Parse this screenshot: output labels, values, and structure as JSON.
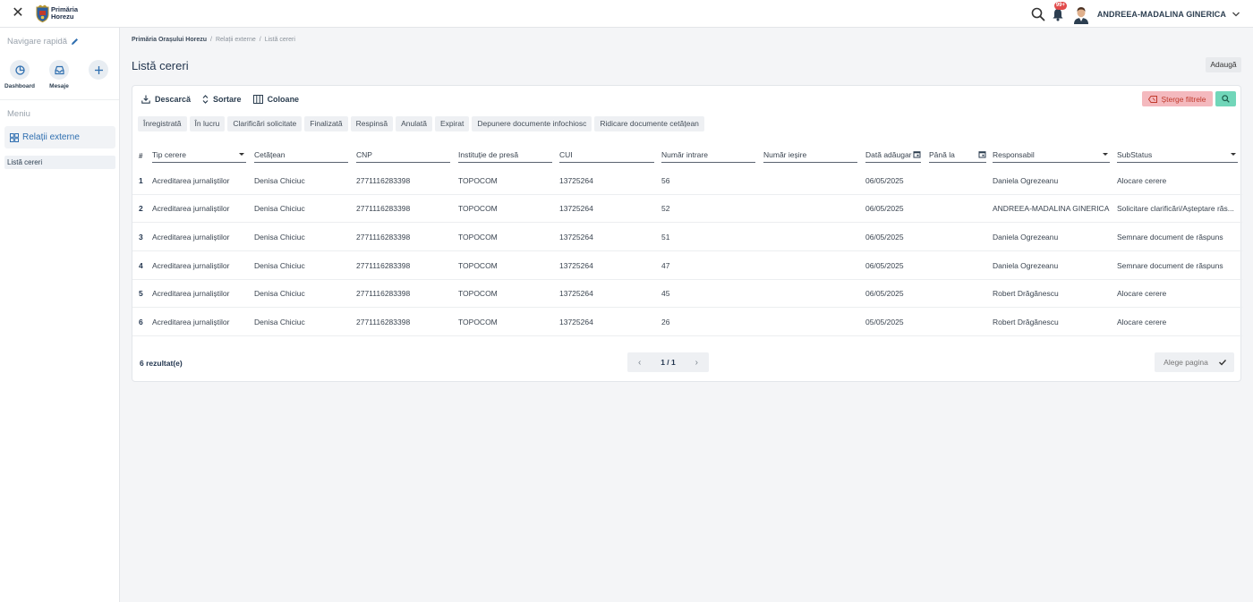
{
  "app": {
    "logo_line1": "Primăria",
    "logo_line2": "Horezu"
  },
  "topbar": {
    "notification_badge": "99+",
    "user_name": "ANDREEA-MADALINA GINERICA"
  },
  "sidebar": {
    "quick_nav_label": "Navigare rapidă",
    "quick_items": [
      {
        "label": "Dashboard",
        "icon": "pie-chart-icon"
      },
      {
        "label": "Mesaje",
        "icon": "inbox-icon"
      },
      {
        "label": "",
        "icon": "plus-icon"
      }
    ],
    "menu_heading": "Meniu",
    "menu_item": "Relații externe",
    "submenu_item": "Listă cereri"
  },
  "breadcrumb": {
    "root": "Primăria Orașului Horezu",
    "sep": "/",
    "section": "Relații externe",
    "current": "Listă cereri"
  },
  "page": {
    "title": "Listă cereri",
    "add_label": "Adaugă"
  },
  "toolbar": {
    "download_label": "Descarcă",
    "sort_label": "Sortare",
    "columns_label": "Coloane",
    "clear_filters_label": "Șterge filtrele"
  },
  "status_tabs": [
    "Înregistrată",
    "În lucru",
    "Clarificări solicitate",
    "Finalizată",
    "Respinsă",
    "Anulată",
    "Expirat",
    "Depunere documente infochiosc",
    "Ridicare documente cetățean"
  ],
  "table": {
    "hash_label": "#",
    "columns": [
      "Tip cerere",
      "Cetățean",
      "CNP",
      "Instituție de presă",
      "CUI",
      "Număr intrare",
      "Număr ieșire",
      "Dată adăugare",
      "Până la",
      "Responsabil",
      "SubStatus"
    ],
    "rows": [
      {
        "num": "1",
        "tip": "Acreditarea jurnaliștilor",
        "cetatean": "Denisa Chiciuc",
        "cnp": "2771116283398",
        "institutie": "TOPOCOM",
        "cui": "13725264",
        "intrare": "56",
        "iesire": "",
        "data": "06/05/2025",
        "pana": "",
        "responsabil": "Daniela Ogrezeanu",
        "substatus": "Alocare cerere"
      },
      {
        "num": "2",
        "tip": "Acreditarea jurnaliștilor",
        "cetatean": "Denisa Chiciuc",
        "cnp": "2771116283398",
        "institutie": "TOPOCOM",
        "cui": "13725264",
        "intrare": "52",
        "iesire": "",
        "data": "06/05/2025",
        "pana": "",
        "responsabil": "ANDREEA-MADALINA GINERICA",
        "substatus": "Solicitare clarificări/Așteptare răs..."
      },
      {
        "num": "3",
        "tip": "Acreditarea jurnaliștilor",
        "cetatean": "Denisa Chiciuc",
        "cnp": "2771116283398",
        "institutie": "TOPOCOM",
        "cui": "13725264",
        "intrare": "51",
        "iesire": "",
        "data": "06/05/2025",
        "pana": "",
        "responsabil": "Daniela Ogrezeanu",
        "substatus": "Semnare document de răspuns"
      },
      {
        "num": "4",
        "tip": "Acreditarea jurnaliștilor",
        "cetatean": "Denisa Chiciuc",
        "cnp": "2771116283398",
        "institutie": "TOPOCOM",
        "cui": "13725264",
        "intrare": "47",
        "iesire": "",
        "data": "06/05/2025",
        "pana": "",
        "responsabil": "Daniela Ogrezeanu",
        "substatus": "Semnare document de răspuns"
      },
      {
        "num": "5",
        "tip": "Acreditarea jurnaliștilor",
        "cetatean": "Denisa Chiciuc",
        "cnp": "2771116283398",
        "institutie": "TOPOCOM",
        "cui": "13725264",
        "intrare": "45",
        "iesire": "",
        "data": "06/05/2025",
        "pana": "",
        "responsabil": "Robert Drăgănescu",
        "substatus": "Alocare cerere"
      },
      {
        "num": "6",
        "tip": "Acreditarea jurnaliștilor",
        "cetatean": "Denisa Chiciuc",
        "cnp": "2771116283398",
        "institutie": "TOPOCOM",
        "cui": "13725264",
        "intrare": "26",
        "iesire": "",
        "data": "05/05/2025",
        "pana": "",
        "responsabil": "Robert Drăgănescu",
        "substatus": "Alocare cerere"
      }
    ]
  },
  "footer": {
    "result_count": "6 rezultat(e)",
    "page_indicator": "1 / 1",
    "page_pick_placeholder": "Alege pagina"
  },
  "colors": {
    "accent": "#2f6fb0",
    "clear_filters_bg": "#f4b9be",
    "search_btn_bg": "#71d6b9",
    "badge": "#e24c4c"
  }
}
